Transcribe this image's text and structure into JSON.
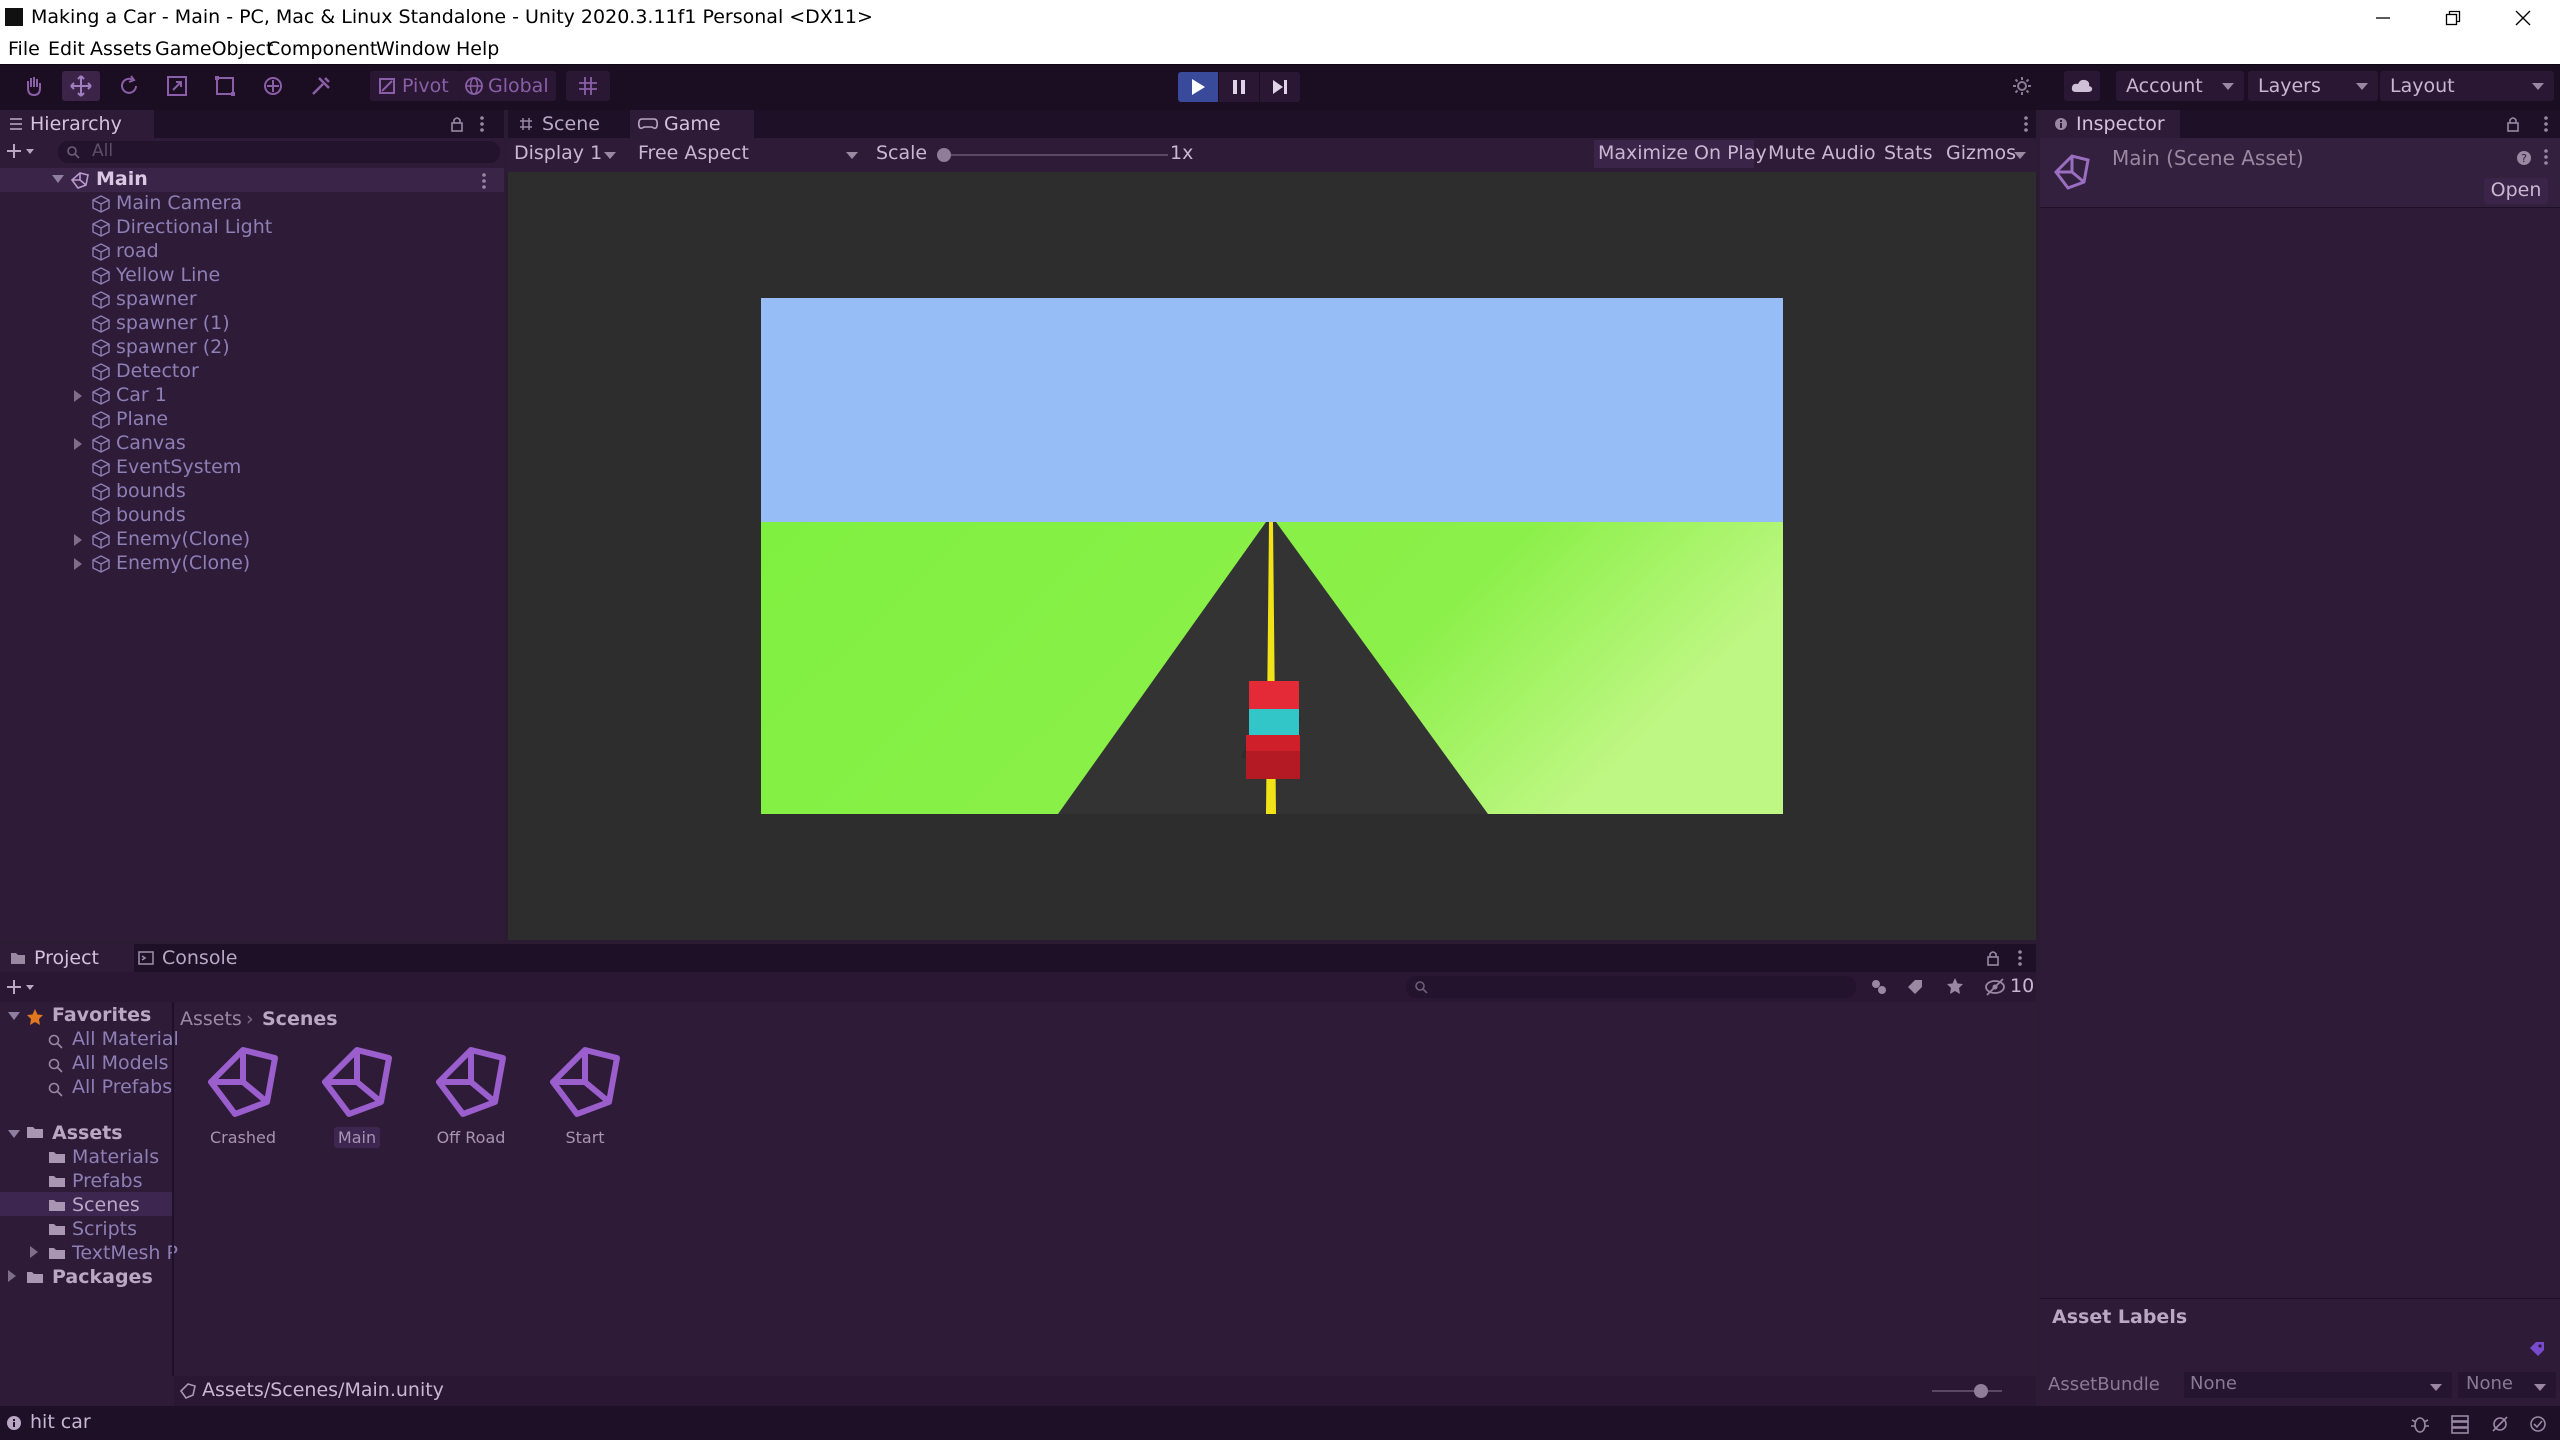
{
  "window": {
    "title": "Making a Car - Main - PC, Mac & Linux Standalone - Unity 2020.3.11f1 Personal <DX11>",
    "controls": [
      "minimize",
      "restore",
      "close"
    ]
  },
  "menu": [
    "File",
    "Edit",
    "Assets",
    "GameObject",
    "Component",
    "Window",
    "Help"
  ],
  "toolbar": {
    "pivot_label": "Pivot",
    "global_label": "Global",
    "account_label": "Account",
    "layers_label": "Layers",
    "layout_label": "Layout",
    "play_state": "playing"
  },
  "hierarchy": {
    "tab_label": "Hierarchy",
    "search_placeholder": "All",
    "scene_name": "Main",
    "items": [
      {
        "label": "Main Camera",
        "expandable": false
      },
      {
        "label": "Directional Light",
        "expandable": false
      },
      {
        "label": "road",
        "expandable": false
      },
      {
        "label": "Yellow Line",
        "expandable": false
      },
      {
        "label": "spawner",
        "expandable": false
      },
      {
        "label": "spawner (1)",
        "expandable": false
      },
      {
        "label": "spawner (2)",
        "expandable": false
      },
      {
        "label": "Detector",
        "expandable": false
      },
      {
        "label": "Car 1",
        "expandable": true
      },
      {
        "label": "Plane",
        "expandable": false
      },
      {
        "label": "Canvas",
        "expandable": true
      },
      {
        "label": "EventSystem",
        "expandable": false
      },
      {
        "label": "bounds",
        "expandable": false
      },
      {
        "label": "bounds",
        "expandable": false
      },
      {
        "label": "Enemy(Clone)",
        "expandable": true
      },
      {
        "label": "Enemy(Clone)",
        "expandable": true
      }
    ]
  },
  "center": {
    "tabs": [
      "Scene",
      "Game"
    ],
    "active_tab": "Game",
    "display_label": "Display 1",
    "aspect_label": "Free Aspect",
    "scale_label": "Scale",
    "scale_value": "1x",
    "maximize_label": "Maximize On Play",
    "mute_label": "Mute Audio",
    "stats_label": "Stats",
    "gizmos_label": "Gizmos"
  },
  "inspector": {
    "tab_label": "Inspector",
    "asset_title": "Main (Scene Asset)",
    "open_label": "Open",
    "asset_labels_heading": "Asset Labels",
    "assetbundle_label": "AssetBundle",
    "assetbundle_value": "None",
    "variant_value": "None"
  },
  "project": {
    "tabs": [
      "Project",
      "Console"
    ],
    "hidden_count": "10",
    "favorites_label": "Favorites",
    "favorites": [
      "All Material",
      "All Models",
      "All Prefabs"
    ],
    "assets_label": "Assets",
    "folders": [
      "Materials",
      "Prefabs",
      "Scenes",
      "Scripts",
      "TextMesh P"
    ],
    "packages_label": "Packages",
    "breadcrumb_root": "Assets",
    "breadcrumb_current": "Scenes",
    "scenes": [
      "Crashed",
      "Main",
      "Off Road",
      "Start"
    ],
    "selected_scene": "Main",
    "footer_path": "Assets/Scenes/Main.unity"
  },
  "status_bar": {
    "message": "hit car"
  },
  "colors": {
    "accent": "#7a4a99",
    "panel_bg": "#2e1b38",
    "sky": "#97bdf7",
    "grass": "#8cf04a",
    "road": "#333333",
    "center_line": "#f2e318",
    "car_red": "#d9222e",
    "car_cyan": "#33c6c9"
  }
}
